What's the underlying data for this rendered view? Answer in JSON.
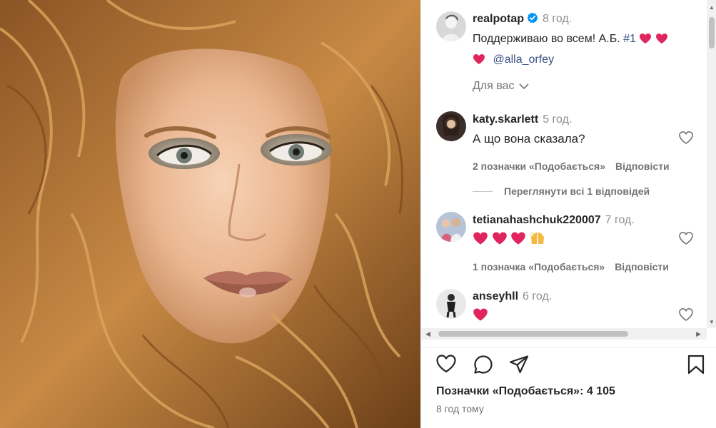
{
  "post": {
    "author": "realpotap",
    "time": "8 год.",
    "caption_text": "Поддерживаю во всем! А.Б.",
    "hashtag": "#1",
    "mention": "@alla_orfey",
    "for_you_label": "Для вас"
  },
  "comments": [
    {
      "user": "katy.skarlett",
      "time": "5 год.",
      "text": "А що вона сказала?",
      "likes_label": "2 позначки «Подобається»",
      "reply_label": "Відповісти"
    },
    {
      "user": "tetianahashchuk220007",
      "time": "7 год.",
      "text": "",
      "likes_label": "1 позначка «Подобається»",
      "reply_label": "Відповісти"
    },
    {
      "user": "anseyhll",
      "time": "6 год.",
      "text": ""
    }
  ],
  "view_replies_label": "Переглянути всі 1 відповідей",
  "footer": {
    "likes_label": "Позначки «Подобається»: 4 105",
    "posted_label": "8 год тому"
  },
  "icons": {
    "like": "heart-outline-icon",
    "comment": "comment-icon",
    "share": "share-paper-plane-icon",
    "save": "bookmark-icon",
    "verified": "verified-badge-icon",
    "emoji_heart": "red-heart-emoji",
    "emoji_hands": "raising-hands-emoji"
  },
  "colors": {
    "link": "#385185",
    "verified": "#0095f6",
    "heart": "#e0245e",
    "muted": "#737373"
  }
}
